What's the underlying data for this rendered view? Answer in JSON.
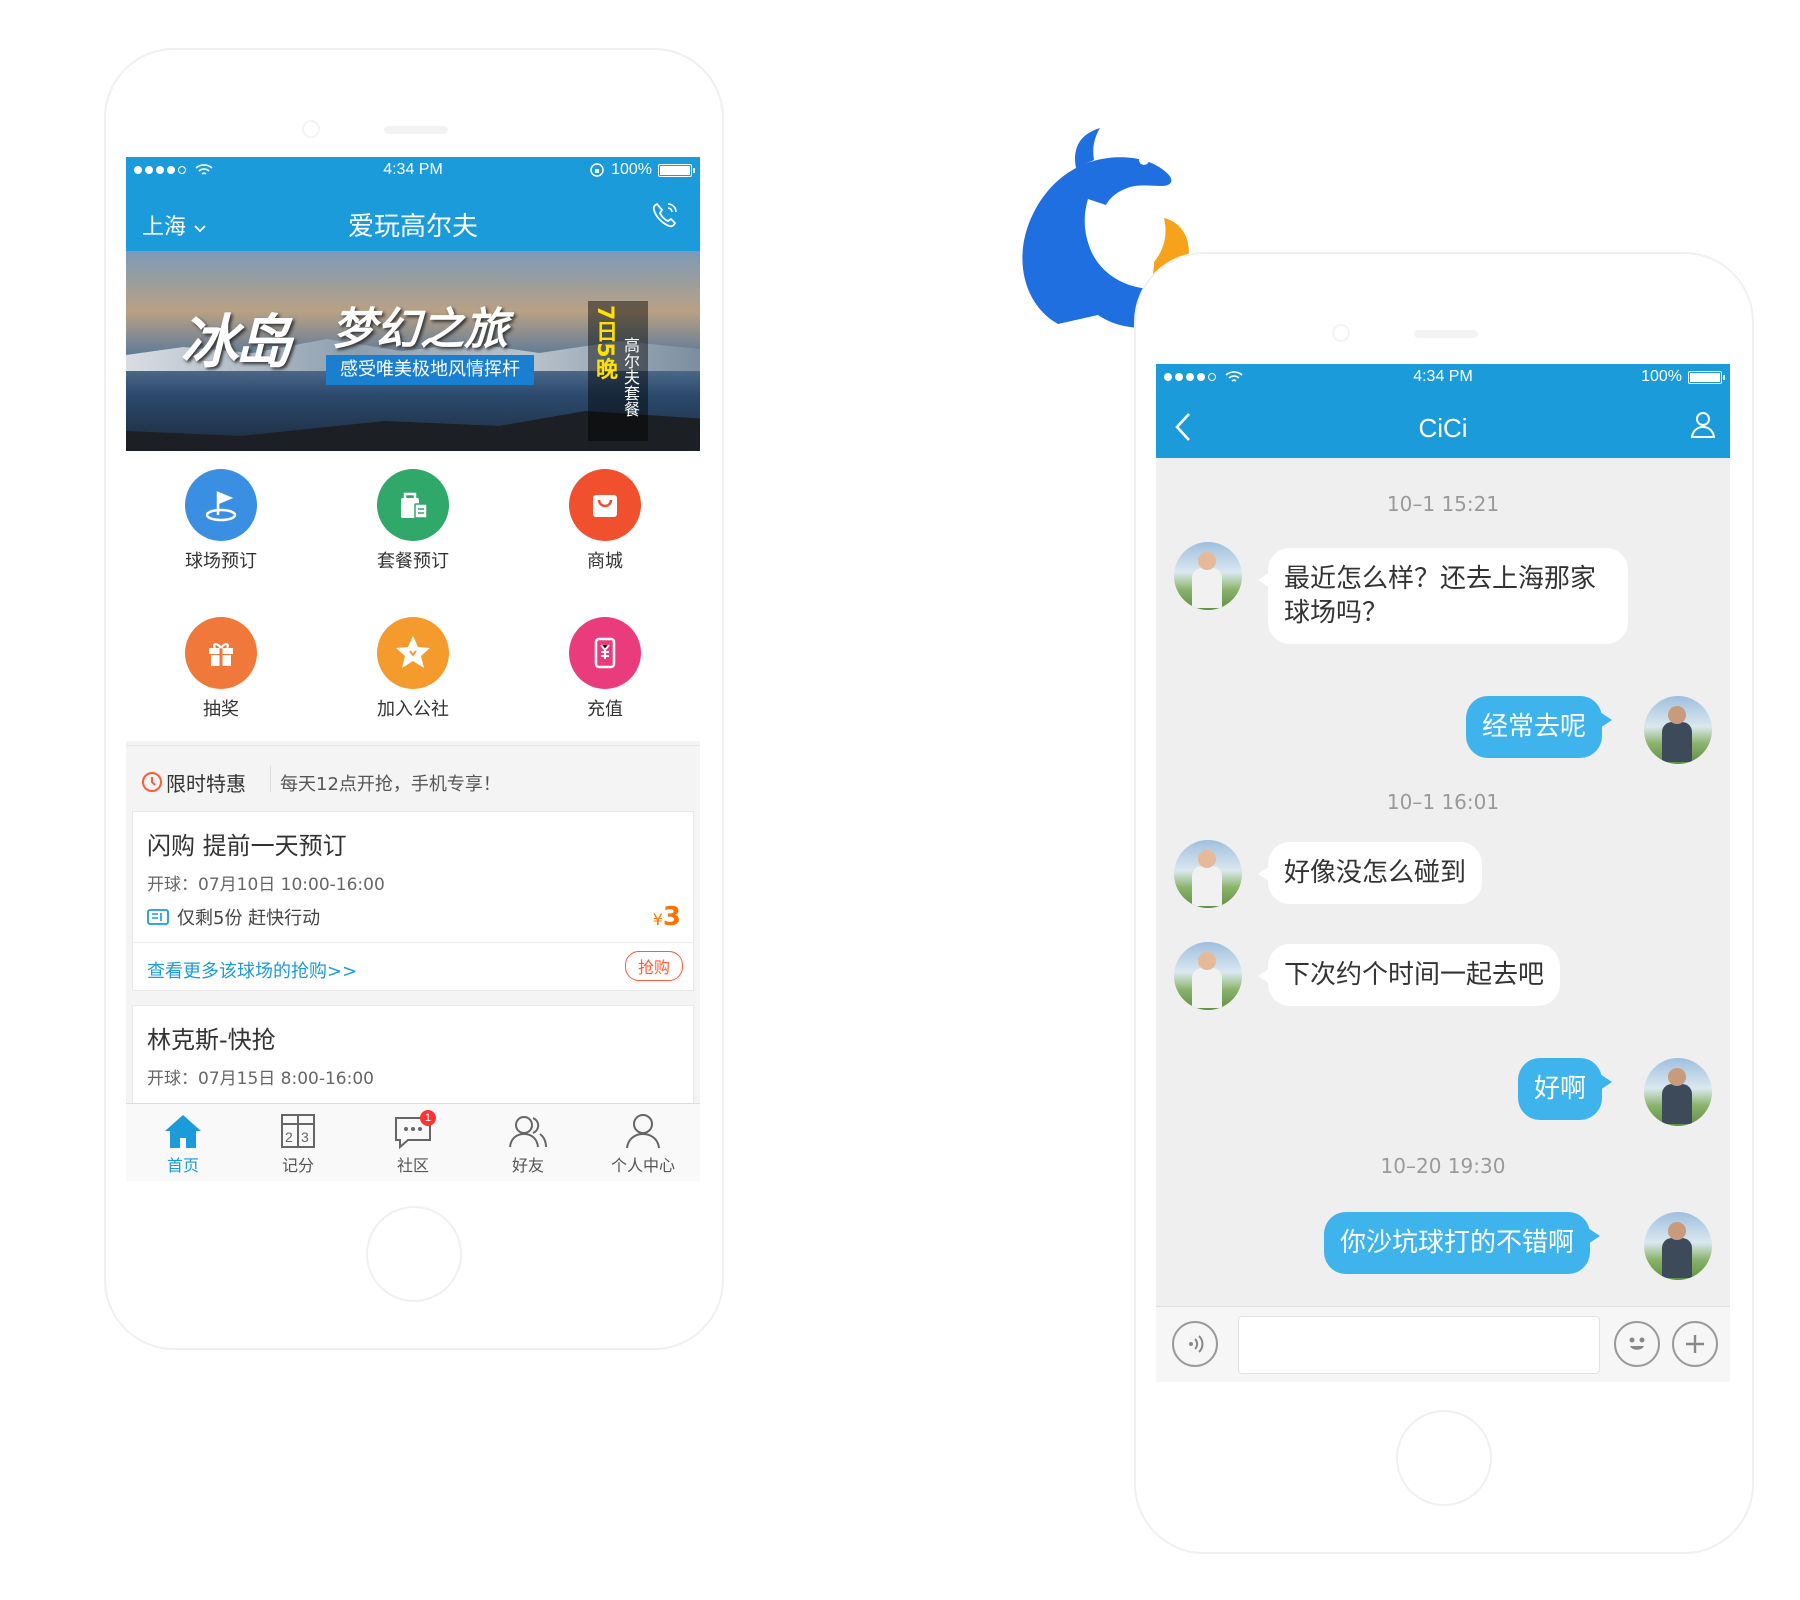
{
  "left_phone": {
    "status": {
      "time": "4:34 PM",
      "battery": "100%"
    },
    "nav": {
      "city": "上海",
      "title": "爱玩高尔夫"
    },
    "banner": {
      "title1": "冰岛",
      "title2": "梦幻之旅",
      "subtitle": "感受唯美极地风情挥杆",
      "side_main": "7日5晚",
      "side_sub": "高尔夫套餐"
    },
    "grid": [
      {
        "label": "球场预订",
        "icon": "golf-flag-icon",
        "color": "#3b8fe3"
      },
      {
        "label": "套餐预订",
        "icon": "package-icon",
        "color": "#2fa86a"
      },
      {
        "label": "商城",
        "icon": "shopping-bag-icon",
        "color": "#f0502e"
      },
      {
        "label": "抽奖",
        "icon": "gift-icon",
        "color": "#f0783a"
      },
      {
        "label": "加入公社",
        "icon": "star-icon",
        "color": "#f59a2c"
      },
      {
        "label": "充值",
        "icon": "recharge-icon",
        "color": "#ea3c7c"
      }
    ],
    "flash": {
      "title": "限时特惠",
      "subtitle": "每天12点开抢，手机专享！"
    },
    "cards": [
      {
        "title": "闪购 提前一天预订",
        "time": "开球：07月10日 10:00-16:00",
        "remaining": "仅剩5份 赶快行动",
        "currency": "¥",
        "price": "3",
        "more": "查看更多该球场的抢购>>",
        "buy": "抢购"
      },
      {
        "title": "林克斯-快抢",
        "time": "开球：07月15日 8:00-16:00"
      }
    ],
    "tabs": [
      {
        "label": "首页",
        "icon": "home-icon"
      },
      {
        "label": "记分",
        "icon": "scorecard-icon"
      },
      {
        "label": "社区",
        "icon": "chat-bubble-icon",
        "badge": "1"
      },
      {
        "label": "好友",
        "icon": "friends-icon"
      },
      {
        "label": "个人中心",
        "icon": "person-icon"
      }
    ]
  },
  "right_phone": {
    "status": {
      "time": "4:34 PM",
      "battery": "100%"
    },
    "nav": {
      "title": "CiCi"
    },
    "timestamps": [
      "10–1 15:21",
      "10–1 16:01",
      "10–20 19:30"
    ],
    "messages": [
      {
        "side": "left",
        "text": "最近怎么样？还去上海那家球场吗？"
      },
      {
        "side": "right",
        "text": "经常去呢"
      },
      {
        "side": "left",
        "text": "好像没怎么碰到"
      },
      {
        "side": "left",
        "text": "下次约个时间一起去吧"
      },
      {
        "side": "right",
        "text": "好啊"
      },
      {
        "side": "right",
        "text": "你沙坑球打的不错啊"
      }
    ]
  },
  "colors": {
    "brand": "#1b9bd9",
    "bubble_self": "#3eb3ec",
    "price": "#ff7200",
    "buy": "#ff5b37",
    "logo_blue": "#1f6fe0",
    "logo_orange": "#f7a21b"
  }
}
